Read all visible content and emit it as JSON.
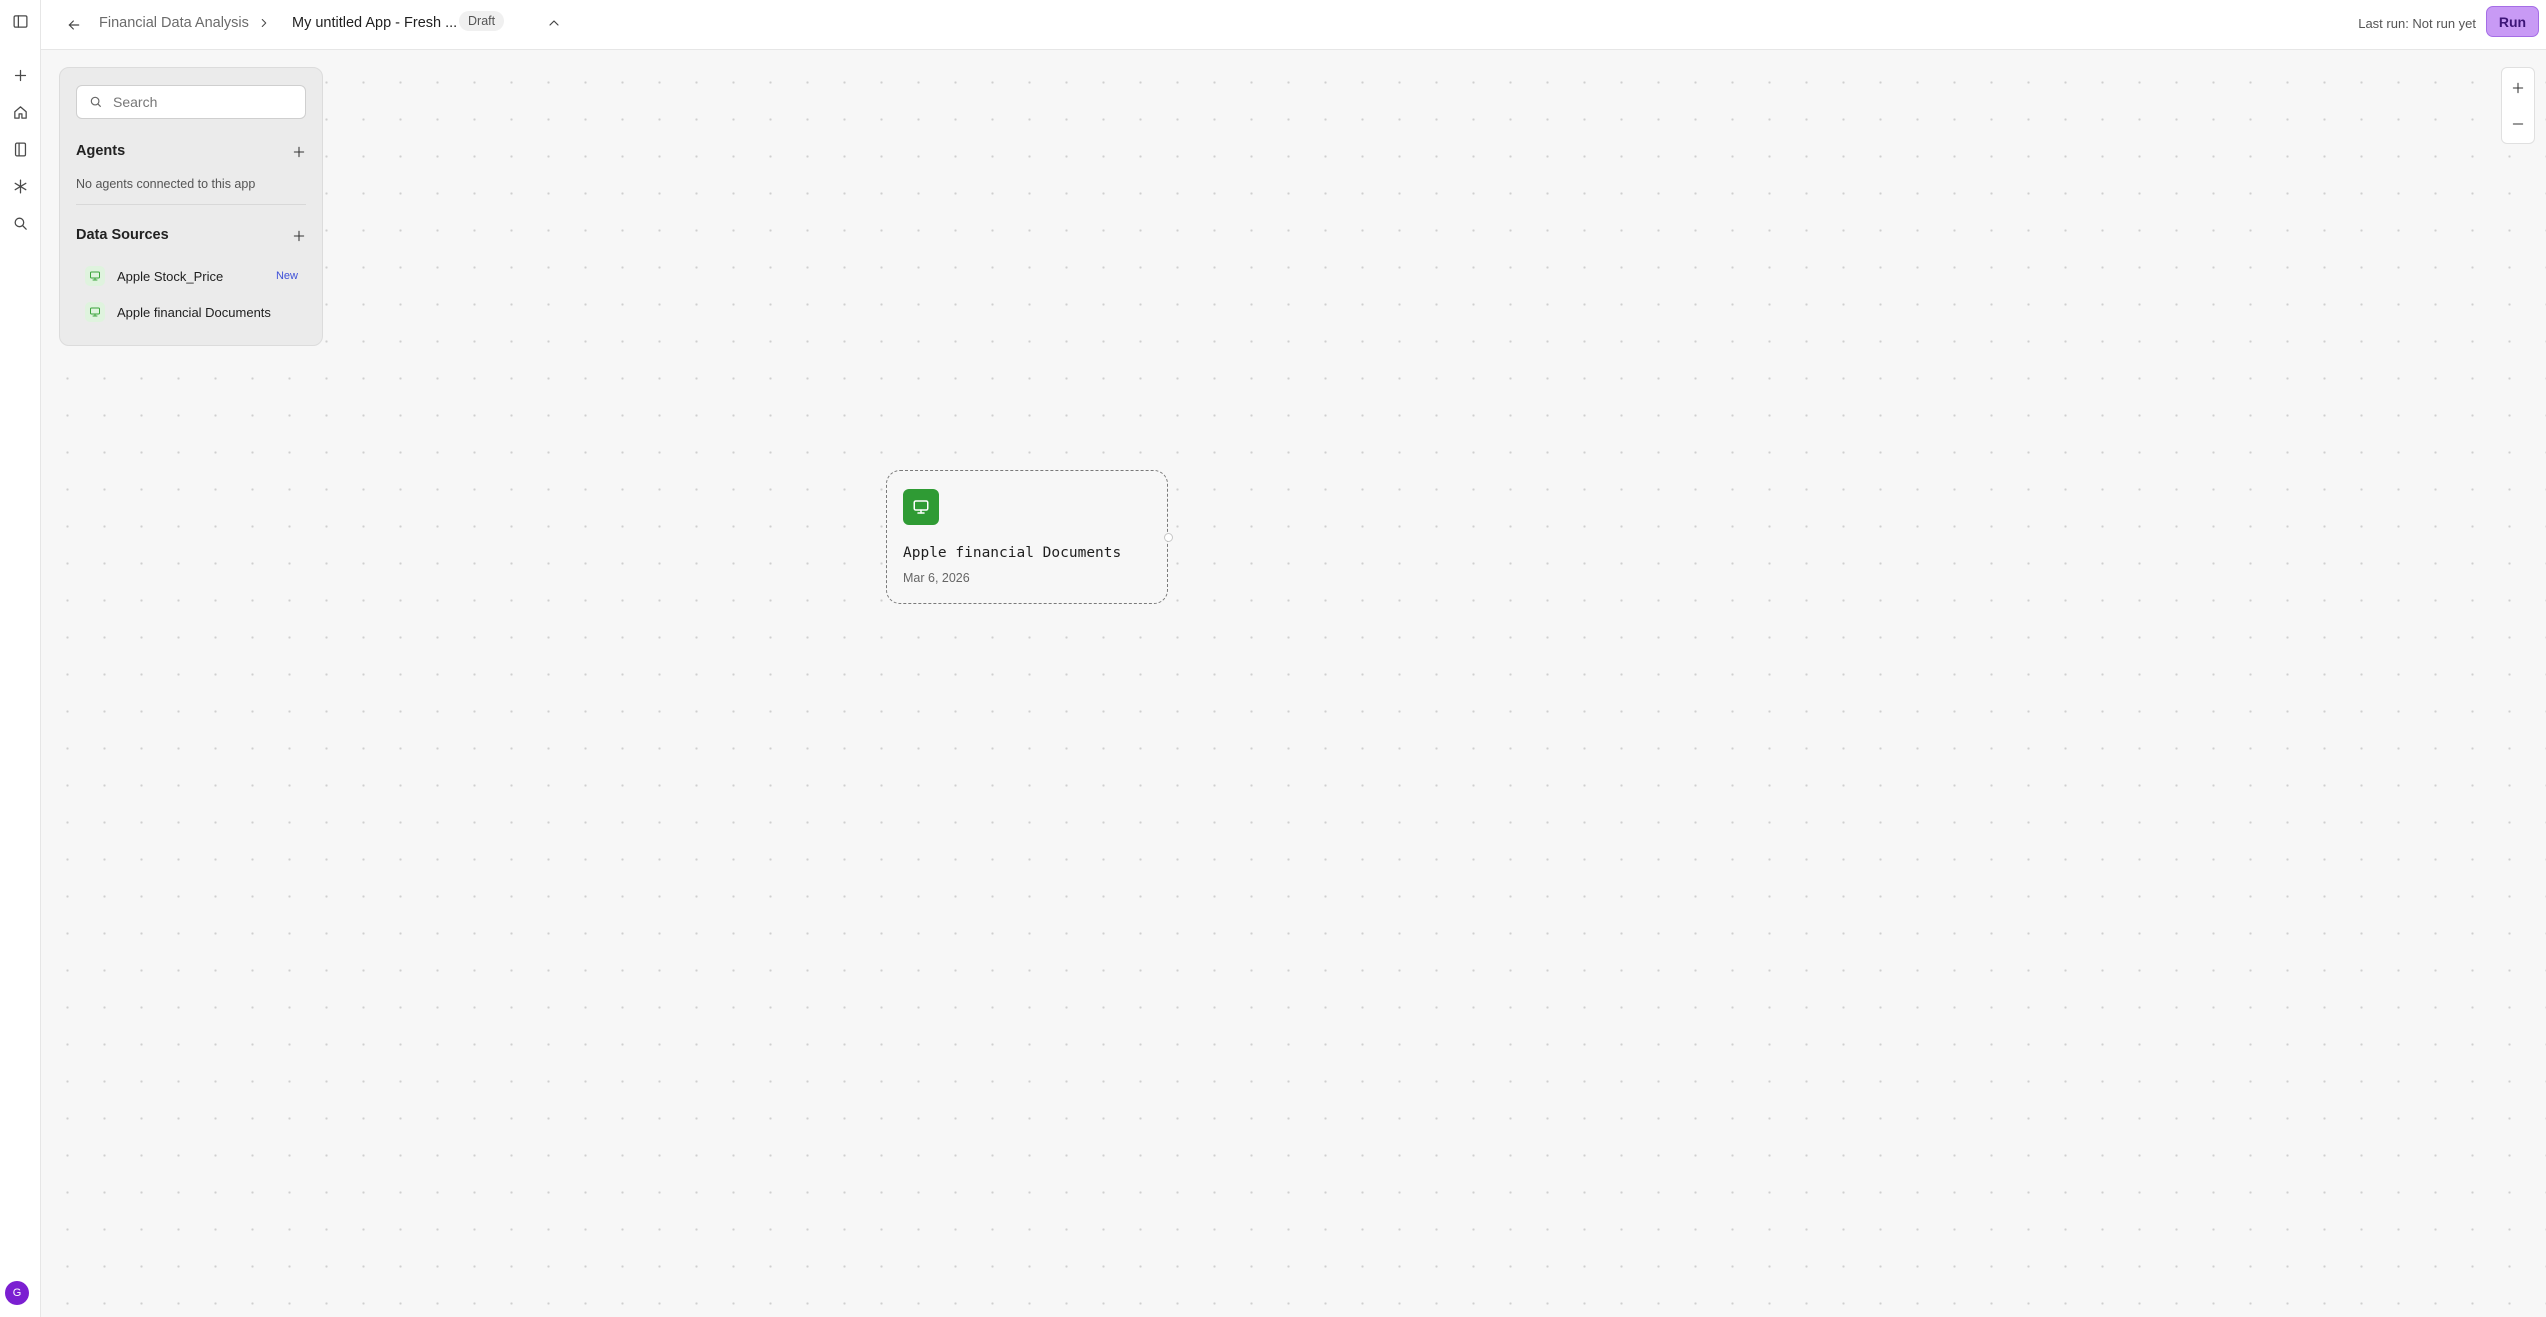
{
  "header": {
    "breadcrumb_parent": "Financial Data Analysis",
    "app_title": "My untitled App - Fresh ...",
    "status_badge": "Draft",
    "last_run": "Last run: Not run yet",
    "run_label": "Run"
  },
  "rail": {
    "icons": [
      "sidebar-toggle-icon",
      "plus-icon",
      "home-icon",
      "book-icon",
      "asterisk-icon",
      "search-icon"
    ],
    "avatar_initial": "G"
  },
  "panel": {
    "search_placeholder": "Search",
    "agents_title": "Agents",
    "agents_empty": "No agents connected to this app",
    "data_sources_title": "Data Sources",
    "data_sources": [
      {
        "label": "Apple Stock_Price",
        "badge": "New"
      },
      {
        "label": "Apple financial Documents",
        "badge": ""
      }
    ]
  },
  "node": {
    "title": "Apple financial Documents",
    "date": "Mar 6, 2026"
  },
  "colors": {
    "run_button": "#c89af5",
    "node_icon": "#2f9b34",
    "avatar": "#7b1fd1",
    "new_badge": "#3f51d8"
  }
}
